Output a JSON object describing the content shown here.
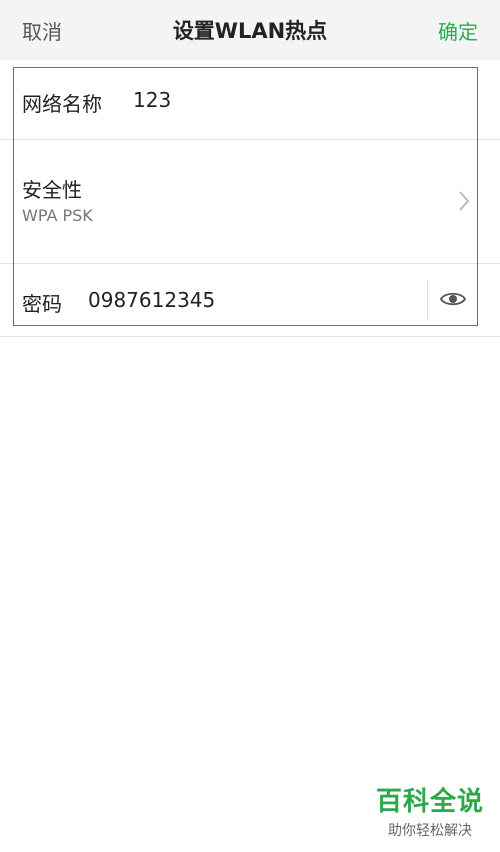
{
  "header": {
    "cancel_label": "取消",
    "title": "设置WLAN热点",
    "confirm_label": "确定"
  },
  "ssid": {
    "label": "网络名称",
    "value": "123"
  },
  "security": {
    "label": "安全性",
    "value": "WPA PSK"
  },
  "password": {
    "label": "密码",
    "value": "0987612345"
  },
  "watermark": {
    "title": "百科全说",
    "subtitle": "助你轻松解决"
  },
  "colors": {
    "accent": "#22b14c",
    "highlight": "#e8393b",
    "header_bg": "#f4f4f4"
  },
  "icons": [
    "chevron-right-icon",
    "eye-icon"
  ]
}
